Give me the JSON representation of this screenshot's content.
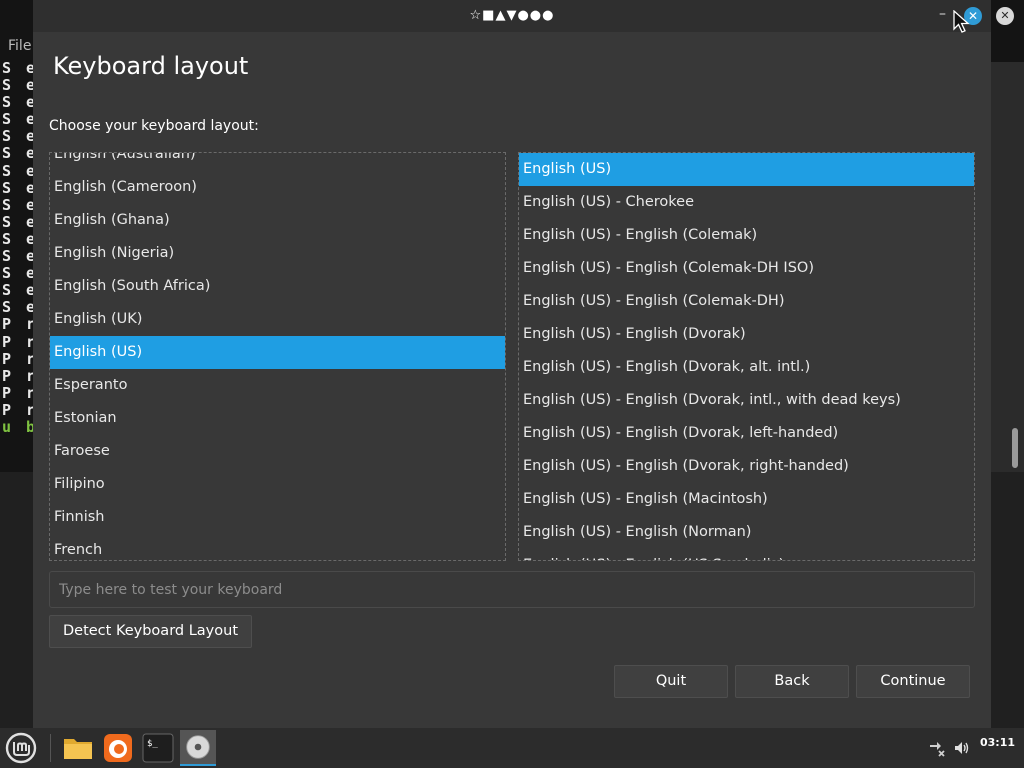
{
  "background": {
    "menu_label": "File",
    "terminal_lines": [
      "S e t",
      "S e t",
      "S e t",
      "S e t",
      "S e t",
      "S e t",
      "S e t",
      "S e t",
      "S e t",
      "S e t",
      "S e t",
      "S e t",
      "S e t",
      "S e t",
      "S e t",
      "P r",
      "P r",
      "P r",
      "P r",
      "P r",
      "P r",
      "u b"
    ]
  },
  "window": {
    "title": "☆■▲▼●●●",
    "minimize_label": "–",
    "close_label": "✕"
  },
  "outer_close_label": "✕",
  "page": {
    "heading": "Keyboard layout",
    "subheading": "Choose your keyboard layout:"
  },
  "left_list": {
    "items": [
      "English (Australian)",
      "English (Cameroon)",
      "English (Ghana)",
      "English (Nigeria)",
      "English (South Africa)",
      "English (UK)",
      "English (US)",
      "Esperanto",
      "Estonian",
      "Faroese",
      "Filipino",
      "Finnish",
      "French"
    ],
    "selected_index": 6
  },
  "right_list": {
    "items": [
      "English (US)",
      "English (US) - Cherokee",
      "English (US) - English (Colemak)",
      "English (US) - English (Colemak-DH ISO)",
      "English (US) - English (Colemak-DH)",
      "English (US) - English (Dvorak)",
      "English (US) - English (Dvorak, alt. intl.)",
      "English (US) - English (Dvorak, intl., with dead keys)",
      "English (US) - English (Dvorak, left-handed)",
      "English (US) - English (Dvorak, right-handed)",
      "English (US) - English (Macintosh)",
      "English (US) - English (Norman)",
      "English (US) - English (US Symbolic)"
    ],
    "selected_index": 0
  },
  "test_input": {
    "placeholder": "Type here to test your keyboard",
    "value": ""
  },
  "buttons": {
    "detect": "Detect Keyboard Layout",
    "quit": "Quit",
    "back": "Back",
    "continue": "Continue"
  },
  "taskbar": {
    "clock": "03:11",
    "icons": [
      "mint-menu-icon",
      "folder-icon",
      "firefox-icon",
      "terminal-icon",
      "disc-installer-icon"
    ],
    "terminal_icon_text": "$_"
  },
  "colors": {
    "selection": "#1f9ee3",
    "window_bg": "#383838",
    "accent": "#2f9bd6",
    "mint_green": "#7fc241"
  }
}
